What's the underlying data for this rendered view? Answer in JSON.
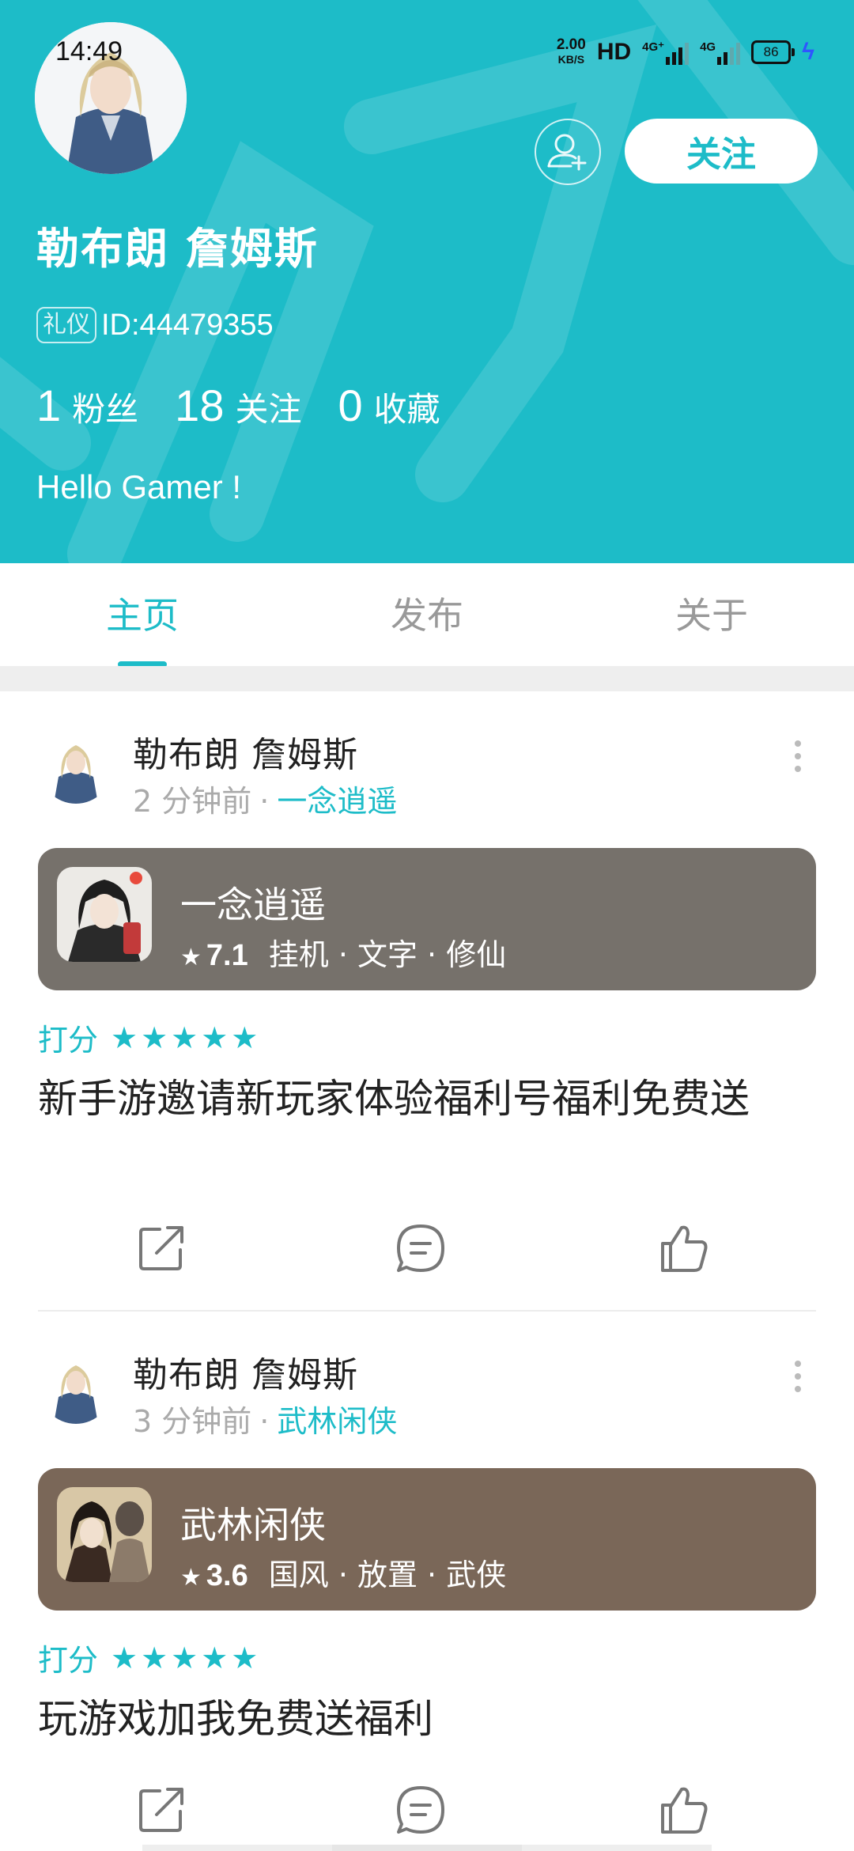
{
  "status_bar": {
    "time": "14:49",
    "net_speed": "2.00",
    "net_speed_unit": "KB/S",
    "hd": "HD",
    "sim1": "4G⁺",
    "sim2": "4G",
    "battery": "86"
  },
  "profile": {
    "name": "勒布朗  詹姆斯",
    "badge": "礼仪",
    "id": "ID:44479355",
    "stats": [
      {
        "num": "1",
        "label": "粉丝"
      },
      {
        "num": "18",
        "label": "关注"
      },
      {
        "num": "0",
        "label": "收藏"
      }
    ],
    "bio": "Hello Gamer !",
    "follow_label": "关注"
  },
  "tabs": [
    "主页",
    "发布",
    "关于"
  ],
  "colors": {
    "accent": "#1dbcc8",
    "card1": "#76716b",
    "card2": "#7a6758"
  },
  "posts": [
    {
      "author": "勒布朗  詹姆斯",
      "time": "2 分钟前",
      "game_link": "一念逍遥",
      "game": {
        "name": "一念逍遥",
        "rating": "7.1",
        "tags": "挂机 · 文字 · 修仙"
      },
      "score_label": "打分",
      "stars": "★★★★★",
      "text": "新手游邀请新玩家体验福利号福利免费送"
    },
    {
      "author": "勒布朗  詹姆斯",
      "time": "3 分钟前",
      "game_link": "武林闲侠",
      "game": {
        "name": "武林闲侠",
        "rating": "3.6",
        "tags": "国风 · 放置 · 武侠"
      },
      "score_label": "打分",
      "stars": "★★★★★",
      "text": "玩游戏加我免费送福利"
    }
  ]
}
